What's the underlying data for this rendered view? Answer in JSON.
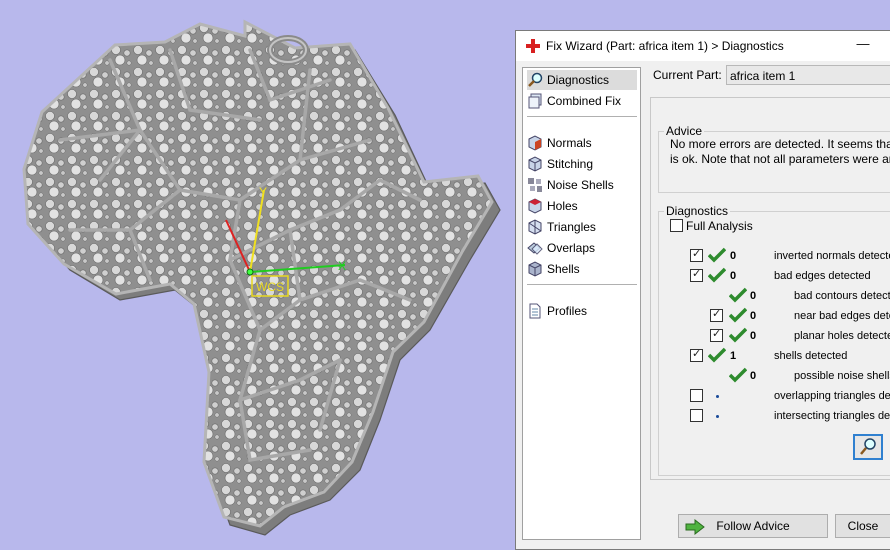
{
  "window": {
    "title": "Fix Wizard (Part: africa item 1) > Diagnostics",
    "minimize": "—"
  },
  "nav": {
    "items": [
      {
        "label": "Diagnostics",
        "icon": "magnifier-icon"
      },
      {
        "label": "Combined Fix",
        "icon": "stacked-pages-icon"
      },
      {
        "label": "Normals",
        "icon": "cube-normals-icon"
      },
      {
        "label": "Stitching",
        "icon": "cube-stitching-icon"
      },
      {
        "label": "Noise Shells",
        "icon": "noise-shells-icon"
      },
      {
        "label": "Holes",
        "icon": "cube-holes-icon"
      },
      {
        "label": "Triangles",
        "icon": "triangles-icon"
      },
      {
        "label": "Overlaps",
        "icon": "overlaps-icon"
      },
      {
        "label": "Shells",
        "icon": "shells-icon"
      },
      {
        "label": "Profiles",
        "icon": "document-icon"
      }
    ]
  },
  "current_part": {
    "label": "Current Part:",
    "value": "africa item 1"
  },
  "advice": {
    "title": "Advice",
    "line1": "No more errors are detected. It seems that th",
    "line2": "is ok. Note that not all parameters were analy"
  },
  "diagnostics": {
    "title": "Diagnostics",
    "full_analysis": "Full Analysis",
    "rows": [
      {
        "count": "0",
        "label": "inverted normals detecte"
      },
      {
        "count": "0",
        "label": "bad edges detected"
      },
      {
        "count": "0",
        "label": "bad contours detect"
      },
      {
        "count": "0",
        "label": "near bad edges dete"
      },
      {
        "count": "0",
        "label": "planar holes detecte"
      },
      {
        "count": "1",
        "label": "shells detected"
      },
      {
        "count": "0",
        "label": "possible noise shells"
      },
      {
        "count": "",
        "label": "overlapping triangles de"
      },
      {
        "count": "",
        "label": "intersecting triangles de"
      }
    ]
  },
  "buttons": {
    "follow_advice": "Follow Advice",
    "close": "Close"
  },
  "viewport": {
    "wcs_label": "WCS",
    "axis_y": "Y",
    "axis_x": "X"
  },
  "colors": {
    "background": "#b8b8ec",
    "model": "#9a9a9a",
    "tick": "#2e8b2e",
    "title_cross": "#d82020"
  }
}
